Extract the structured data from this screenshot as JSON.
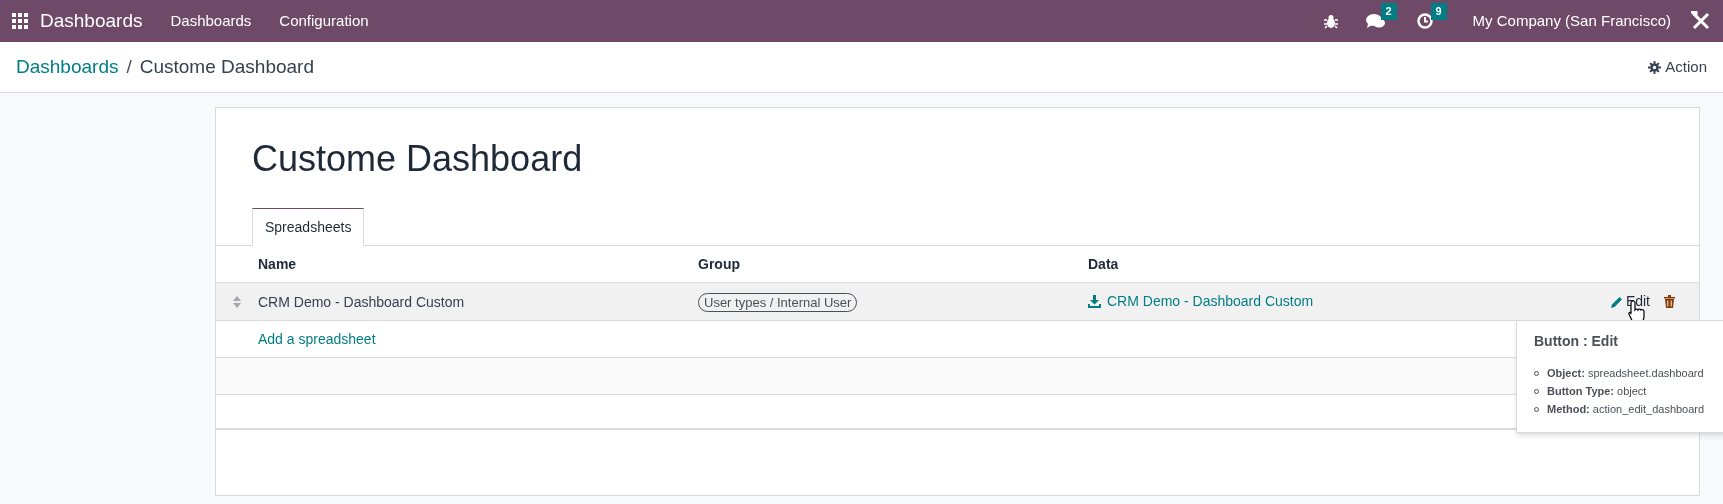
{
  "navbar": {
    "app_name": "Dashboards",
    "menu": [
      "Dashboards",
      "Configuration"
    ],
    "messages_count": "2",
    "activities_count": "9",
    "company": "My Company (San Francisco)"
  },
  "breadcrumb": {
    "parent": "Dashboards",
    "separator": "/",
    "current": "Custome Dashboard"
  },
  "action_button": "Action",
  "form": {
    "title": "Custome Dashboard",
    "tabs": [
      {
        "label": "Spreadsheets",
        "selected": true
      }
    ],
    "table": {
      "columns": [
        "Name",
        "Group",
        "Data"
      ],
      "rows": [
        {
          "name": "CRM Demo - Dashboard Custom",
          "group": "User types / Internal User",
          "data": "CRM Demo - Dashboard Custom",
          "edit": "Edit",
          "hovered": true
        }
      ],
      "add_line": "Add a spreadsheet"
    }
  },
  "tooltip": {
    "title": "Button : Edit",
    "items": [
      "**Object:** spreadsheet.dashboard",
      "**Button Type:** object",
      "**Method:** action_edit_dashboard"
    ]
  }
}
